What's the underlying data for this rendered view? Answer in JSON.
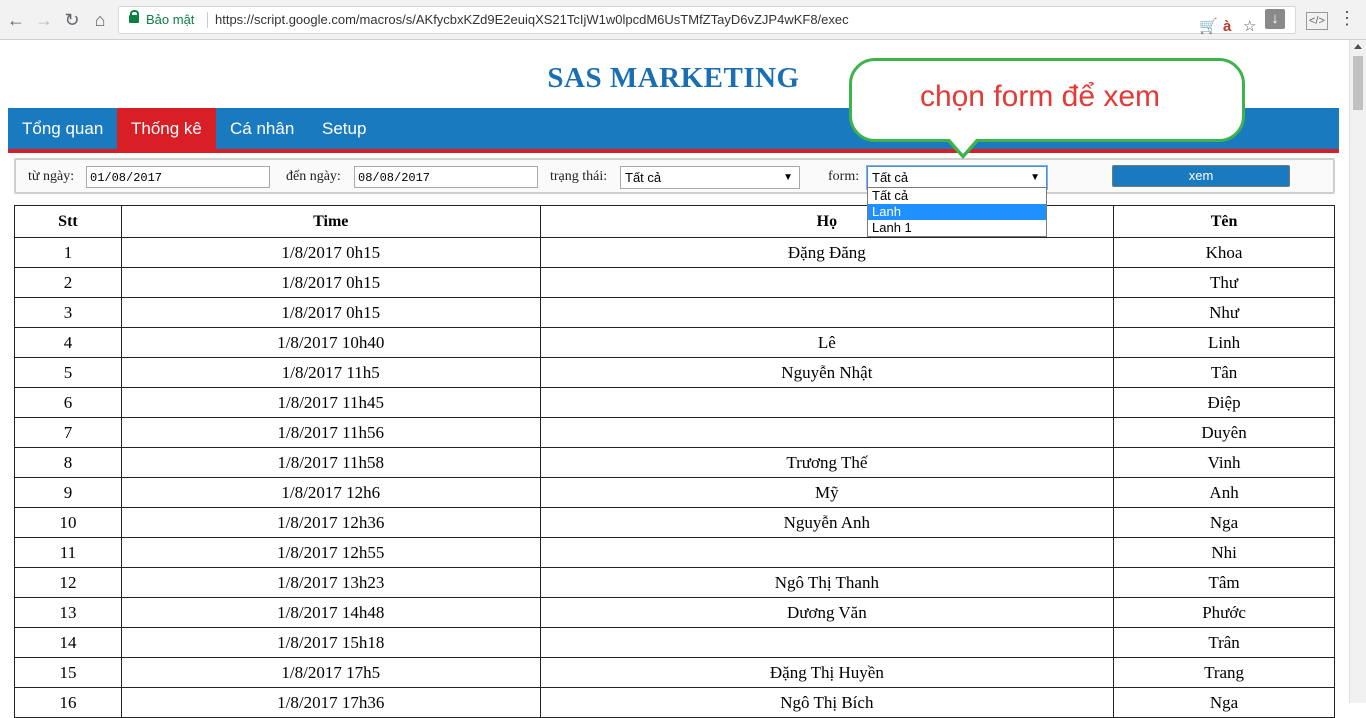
{
  "browser": {
    "secure_label": "Bảo mật",
    "url": "https://script.google.com/macros/s/AKfycbxKZd9E2euiqXS21TcIjW1w0lpcdM6UsTMfZTayD6vZJP4wKF8/exec",
    "back_icon": "back-arrow-icon",
    "forward_icon": "forward-arrow-icon",
    "reload_icon": "reload-icon",
    "home_icon": "home-icon"
  },
  "page": {
    "title": "SAS MARKETING"
  },
  "menu": {
    "items": [
      {
        "label": "Tổng quan"
      },
      {
        "label": "Thống kê"
      },
      {
        "label": "Cá nhân"
      },
      {
        "label": "Setup"
      }
    ],
    "active": "Thống kê"
  },
  "filters": {
    "from_label": "từ ngày:",
    "from_value": "01/08/2017",
    "to_label": "đến ngày:",
    "to_value": "08/08/2017",
    "status_label": "trạng thái:",
    "status_value": "Tất cả",
    "form_label": "form:",
    "form_value": "Tất cả",
    "form_options": [
      {
        "label": "Tất cả"
      },
      {
        "label": "Lanh"
      },
      {
        "label": "Lanh 1"
      }
    ],
    "form_highlighted": "Lanh",
    "submit_label": "xem"
  },
  "callout": {
    "text": "chọn form để xem"
  },
  "table": {
    "headers": [
      "Stt",
      "Time",
      "Họ",
      "Tên"
    ],
    "rows": [
      [
        "1",
        "1/8/2017 0h15",
        "Đặng Đăng",
        "Khoa"
      ],
      [
        "2",
        "1/8/2017 0h15",
        "",
        "Thư"
      ],
      [
        "3",
        "1/8/2017 0h15",
        "",
        "Như"
      ],
      [
        "4",
        "1/8/2017 10h40",
        "Lê",
        "Linh"
      ],
      [
        "5",
        "1/8/2017 11h5",
        "Nguyễn Nhật",
        "Tân"
      ],
      [
        "6",
        "1/8/2017 11h45",
        "",
        "Điệp"
      ],
      [
        "7",
        "1/8/2017 11h56",
        "",
        "Duyên"
      ],
      [
        "8",
        "1/8/2017 11h58",
        "Trương Thế",
        "Vinh"
      ],
      [
        "9",
        "1/8/2017 12h6",
        "Mỹ",
        "Anh"
      ],
      [
        "10",
        "1/8/2017 12h36",
        "Nguyễn Anh",
        "Nga"
      ],
      [
        "11",
        "1/8/2017 12h55",
        "",
        "Nhi"
      ],
      [
        "12",
        "1/8/2017 13h23",
        "Ngô Thị Thanh",
        "Tâm"
      ],
      [
        "13",
        "1/8/2017 14h48",
        "Dương Văn",
        "Phước"
      ],
      [
        "14",
        "1/8/2017 15h18",
        "",
        "Trân"
      ],
      [
        "15",
        "1/8/2017 17h5",
        "Đặng Thị Huyền",
        "Trang"
      ],
      [
        "16",
        "1/8/2017 17h36",
        "Ngô Thị Bích",
        "Nga"
      ]
    ]
  }
}
